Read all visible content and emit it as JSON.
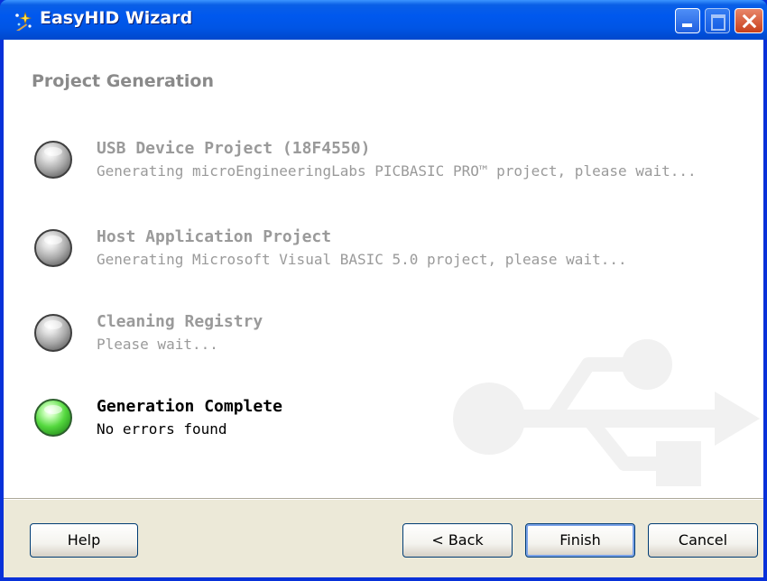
{
  "window": {
    "title": "EasyHID Wizard",
    "title_icon": "wizard-sparkle-icon"
  },
  "page": {
    "title": "Project Generation"
  },
  "steps": [
    {
      "title": "USB Device Project (18F4550)",
      "description": "Generating microEngineeringLabs PICBASIC PRO™ project, please wait...",
      "status": "inactive",
      "indicator": "gray-led-icon"
    },
    {
      "title": "Host Application Project",
      "description": "Generating Microsoft Visual BASIC 5.0 project, please wait...",
      "status": "inactive",
      "indicator": "gray-led-icon"
    },
    {
      "title": "Cleaning Registry",
      "description": "Please wait...",
      "status": "inactive",
      "indicator": "gray-led-icon"
    },
    {
      "title": "Generation Complete",
      "description": "No errors found",
      "status": "active",
      "indicator": "green-led-icon"
    }
  ],
  "buttons": {
    "help": "Help",
    "back": "< Back",
    "finish": "Finish",
    "cancel": "Cancel"
  },
  "colors": {
    "titlebar": "#0058ee",
    "inactive_text": "#9a9a9a",
    "active_text": "#000000",
    "led_on": "#54d83e",
    "dialog_face": "#ece9d8"
  }
}
